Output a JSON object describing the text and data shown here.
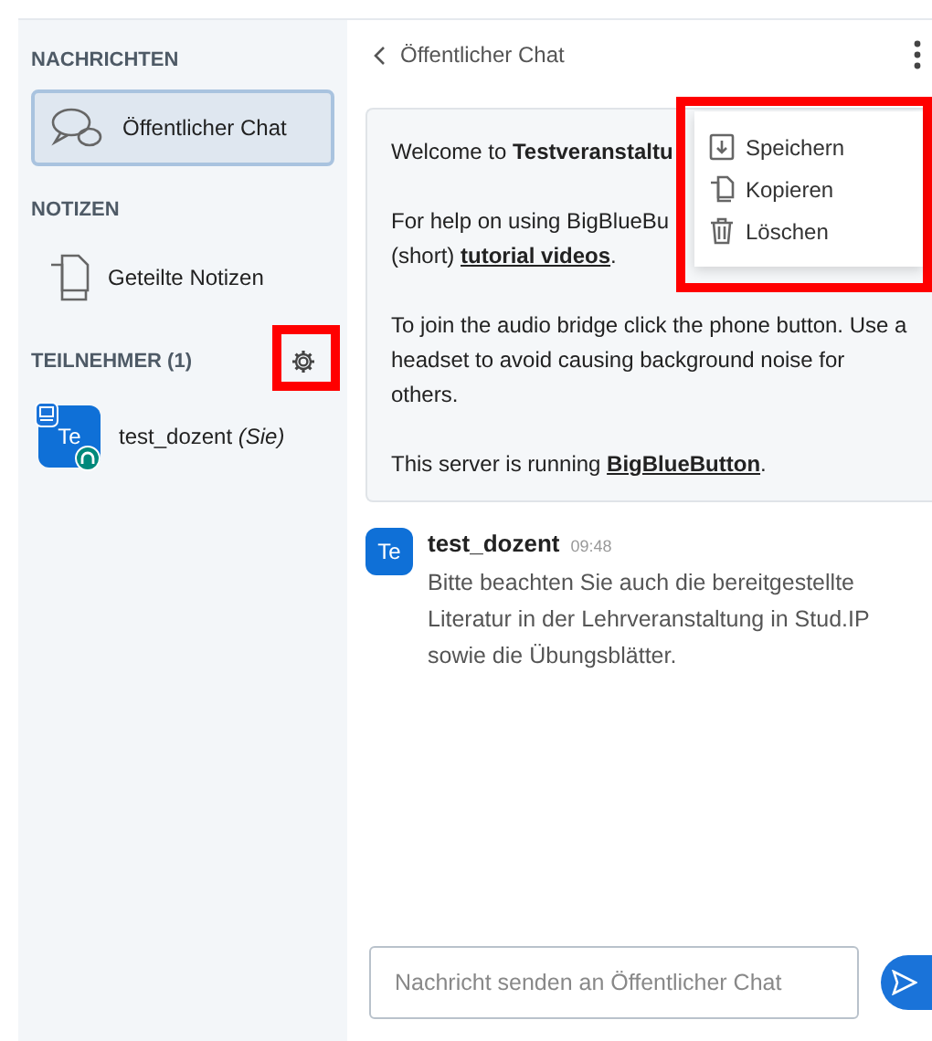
{
  "sidebar": {
    "sections": [
      {
        "title": "NACHRICHTEN",
        "items": [
          {
            "kind": "chat",
            "label": "Öffentlicher Chat",
            "selected": true
          }
        ]
      },
      {
        "title": "NOTIZEN",
        "items": [
          {
            "kind": "notes",
            "label": "Geteilte Notizen",
            "selected": false
          }
        ]
      },
      {
        "title": "TEILNEHMER (1)",
        "settings": true,
        "highlighted": true,
        "items": [
          {
            "kind": "user",
            "avatar": "Te",
            "name": "test_dozent",
            "suffix": "(Sie)",
            "presenter": true,
            "audio": true,
            "selected": false
          }
        ]
      }
    ]
  },
  "chat": {
    "title": "Öffentlicher Chat",
    "welcome": [
      [
        {
          "kind": "text",
          "text": "Welcome to "
        },
        {
          "kind": "bold",
          "text": "Testveranstaltu"
        }
      ],
      [
        {
          "kind": "text",
          "text": "For help on using BigBlueBu"
        }
      ],
      [
        {
          "kind": "text",
          "text": "(short) "
        },
        {
          "kind": "link",
          "text": "tutorial videos"
        },
        {
          "kind": "text",
          "text": "."
        }
      ],
      [
        {
          "kind": "text",
          "text": "To join the audio bridge click the phone button. Use a headset to avoid causing background noise for others."
        }
      ],
      [
        {
          "kind": "text",
          "text": "This server is running "
        },
        {
          "kind": "link",
          "text": "BigBlueButton"
        },
        {
          "kind": "text",
          "text": "."
        }
      ]
    ],
    "messages": [
      {
        "avatar": "Te",
        "author": "test_dozent",
        "time": "09:48",
        "text": "Bitte beachten Sie auch die bereitgestellte Literatur in der Lehrveranstaltung in Stud.IP sowie die Übungsblätter."
      }
    ],
    "input": {
      "placeholder": "Nachricht senden an Öffentlicher Chat"
    },
    "menu": {
      "highlighted": true,
      "items": [
        {
          "kind": "save",
          "label": "Speichern"
        },
        {
          "kind": "copy",
          "label": "Kopieren"
        },
        {
          "kind": "delete",
          "label": "Löschen"
        }
      ]
    }
  }
}
